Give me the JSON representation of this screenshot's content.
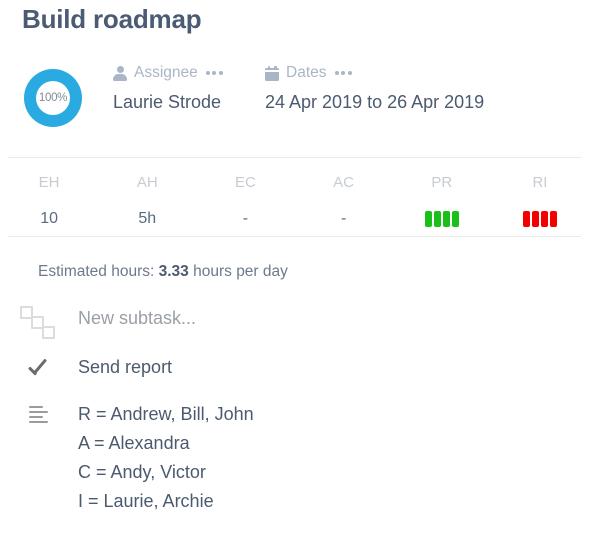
{
  "task": {
    "title": "Build roadmap",
    "progress": {
      "percent_label": "100%",
      "percent": 100,
      "color": "#29abe2"
    }
  },
  "fields": {
    "assignee": {
      "label": "Assignee",
      "icon": "person-icon",
      "value": "Laurie Strode",
      "menu": "more-options"
    },
    "dates": {
      "label": "Dates",
      "icon": "calendar-icon",
      "value": "24 Apr 2019 to 26 Apr 2019",
      "menu": "more-options"
    }
  },
  "metrics": [
    {
      "label": "EH",
      "value": "10",
      "type": "text"
    },
    {
      "label": "AH",
      "value": "5h",
      "type": "text"
    },
    {
      "label": "EC",
      "value": "-",
      "type": "text"
    },
    {
      "label": "AC",
      "value": "-",
      "type": "text"
    },
    {
      "label": "PR",
      "value": "",
      "type": "bars",
      "bars": 4,
      "bar_color": "#18c018"
    },
    {
      "label": "RI",
      "value": "",
      "type": "bars",
      "bars": 4,
      "bar_color": "#f50000"
    }
  ],
  "estimated_hours": {
    "prefix": "Estimated hours:",
    "amount": "3.33",
    "suffix": "hours per day"
  },
  "rows": {
    "subtask": {
      "icon": "subtask-icon",
      "placeholder": "New subtask..."
    },
    "report": {
      "icon": "check-icon",
      "text": "Send report"
    },
    "notes": {
      "icon": "align-left-icon",
      "lines": [
        "R = Andrew, Bill, John",
        "A = Alexandra",
        "C = Andy, Victor",
        "I = Laurie, Archie"
      ]
    }
  }
}
